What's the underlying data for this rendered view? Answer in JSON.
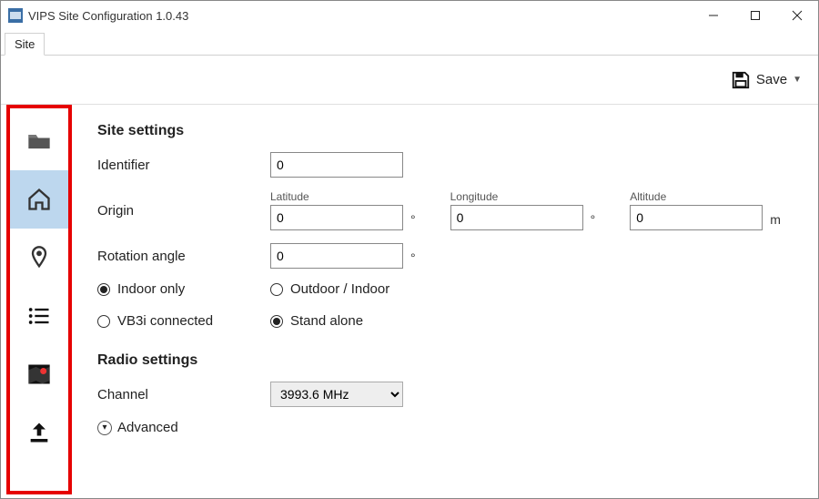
{
  "window": {
    "title": "VIPS Site Configuration 1.0.43"
  },
  "menubar": {
    "items": [
      "Site"
    ]
  },
  "toolbar": {
    "save_label": "Save"
  },
  "sidebar": {
    "items": [
      {
        "icon": "folder-icon",
        "selected": false
      },
      {
        "icon": "home-icon",
        "selected": true
      },
      {
        "icon": "pin-icon",
        "selected": false
      },
      {
        "icon": "list-icon",
        "selected": false
      },
      {
        "icon": "map-icon",
        "selected": false
      },
      {
        "icon": "upload-icon",
        "selected": false
      }
    ]
  },
  "site_settings": {
    "heading": "Site settings",
    "identifier_label": "Identifier",
    "identifier_value": "0",
    "origin_label": "Origin",
    "latitude_label": "Latitude",
    "latitude_value": "0",
    "longitude_label": "Longitude",
    "longitude_value": "0",
    "altitude_label": "Altitude",
    "altitude_value": "0",
    "altitude_unit": "m",
    "degree_unit": "°",
    "rotation_label": "Rotation angle",
    "rotation_value": "0",
    "mode_group": {
      "indoor_label": "Indoor only",
      "outdoor_label": "Outdoor / Indoor",
      "selected": "indoor"
    },
    "connection_group": {
      "vb3i_label": "VB3i connected",
      "standalone_label": "Stand alone",
      "selected": "standalone"
    }
  },
  "radio_settings": {
    "heading": "Radio settings",
    "channel_label": "Channel",
    "channel_value": "3993.6 MHz",
    "advanced_label": "Advanced"
  }
}
